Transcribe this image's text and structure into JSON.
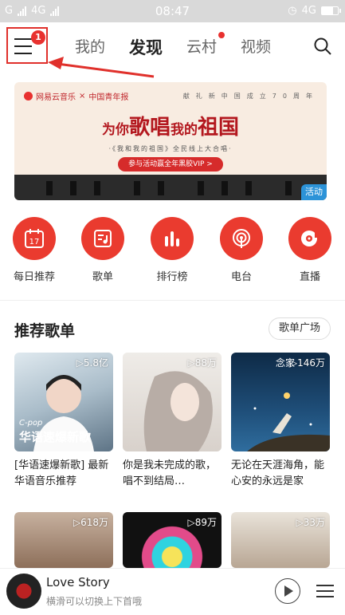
{
  "status_bar": {
    "carrier_left": "G",
    "network_left": "4G",
    "time": "08:47",
    "network_right": "4G"
  },
  "top_nav": {
    "menu_badge": "1",
    "tabs": [
      {
        "label": "我的",
        "active": false,
        "dot": false
      },
      {
        "label": "发现",
        "active": true,
        "dot": false
      },
      {
        "label": "云村",
        "active": false,
        "dot": true
      },
      {
        "label": "视频",
        "active": false,
        "dot": false
      }
    ]
  },
  "banner": {
    "brand": "网易云音乐",
    "partner": "中国青年报",
    "slogan_top": "献礼新中国成立70周年",
    "headline_a": "为你",
    "headline_b": "歌唱",
    "headline_c": "我的",
    "headline_d": "祖国",
    "sub": "·《我和我的祖国》全民线上大合唱·",
    "cta": "参与活动赢全年黑胶VIP >",
    "tag": "活动"
  },
  "quick_links": [
    {
      "label": "每日推荐",
      "icon": "calendar-icon",
      "day": "17"
    },
    {
      "label": "歌单",
      "icon": "playlist-icon"
    },
    {
      "label": "排行榜",
      "icon": "chart-bars-icon"
    },
    {
      "label": "电台",
      "icon": "podcast-icon"
    },
    {
      "label": "直播",
      "icon": "live-icon"
    }
  ],
  "recommend": {
    "title": "推荐歌单",
    "plaza": "歌单广场",
    "playlists": [
      {
        "plays": "▷5.8亿",
        "title": "[华语速爆新歌] 最新华语音乐推荐",
        "cover_text": "华语速爆新歌",
        "cover_sub": "C-pop"
      },
      {
        "plays": "▷88万",
        "title": "你是我未完成的歌，唱不到结局…"
      },
      {
        "plays": "▷146万",
        "title": "无论在天涯海角，能心安的永远是家",
        "cover_text": "念家"
      },
      {
        "plays": "▷618万",
        "title": ""
      },
      {
        "plays": "▷89万",
        "title": ""
      },
      {
        "plays": "▷33万",
        "title": ""
      }
    ]
  },
  "player": {
    "song": "Love Story",
    "hint": "横滑可以切换上下首哦"
  },
  "colors": {
    "accent": "#e8312f",
    "annotation": "#e0302b"
  }
}
